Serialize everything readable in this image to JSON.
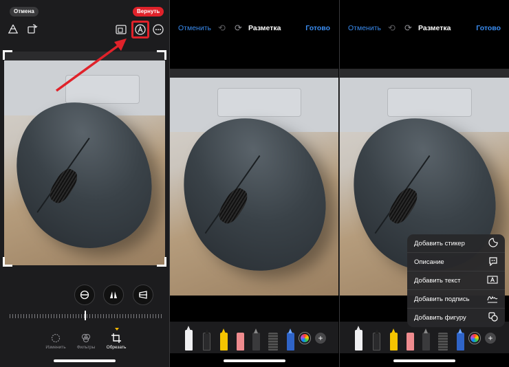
{
  "left_screen": {
    "cancel_pill": "Отмена",
    "revert_pill": "Вернуть",
    "top_icons": [
      "perspective-icon",
      "rotate-icon",
      "aspect-ratio-icon",
      "markup-icon",
      "more-icon"
    ],
    "tabs": [
      {
        "label": "Изменить",
        "icon": "adjust-icon",
        "active": false
      },
      {
        "label": "Фильтры",
        "icon": "filters-icon",
        "active": false
      },
      {
        "label": "Обрезать",
        "icon": "crop-icon",
        "active": true
      }
    ]
  },
  "markup_screen": {
    "cancel_label": "Отменить",
    "title": "Разметка",
    "done_label": "Готово"
  },
  "markup_menu_screen": {
    "cancel_label": "Отменить",
    "title": "Разметка",
    "done_label": "Готово",
    "menu": [
      {
        "label": "Добавить стикер",
        "icon": "sticker-icon"
      },
      {
        "label": "Описание",
        "icon": "description-icon"
      },
      {
        "label": "Добавить текст",
        "icon": "text-box-icon"
      },
      {
        "label": "Добавить подпись",
        "icon": "signature-icon"
      },
      {
        "label": "Добавить фигуру",
        "icon": "shapes-icon"
      }
    ]
  },
  "colors": {
    "accent_blue": "#3a8cf0",
    "highlight_red": "#e0222a",
    "panel_dark": "#1c1c1e"
  }
}
